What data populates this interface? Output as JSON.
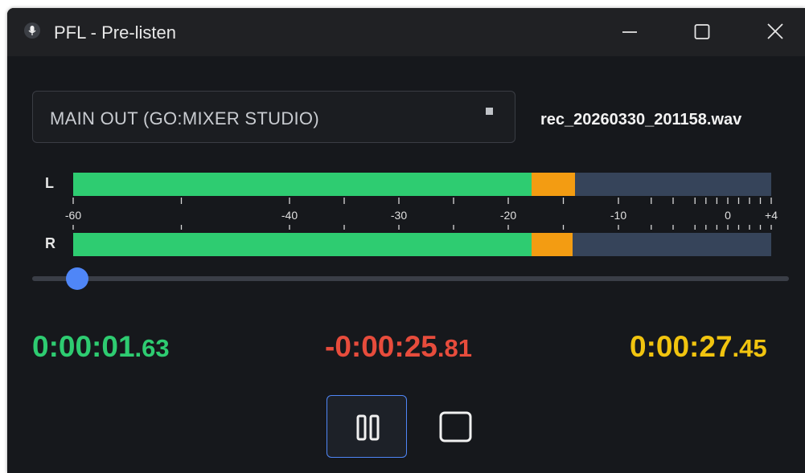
{
  "window": {
    "title": "PFL - Pre-listen",
    "icons": [
      "microphone-icon",
      "minimize-icon",
      "maximize-icon",
      "close-icon"
    ]
  },
  "device": {
    "selected": "MAIN OUT (GO:MIXER STUDIO)"
  },
  "file": {
    "name": "rec_20260330_201158.wav"
  },
  "meters": {
    "left": {
      "label": "L",
      "green_fraction": 0.657,
      "orange_fraction": 0.062
    },
    "right": {
      "label": "R",
      "green_fraction": 0.657,
      "orange_fraction": 0.059
    },
    "scale_labels": [
      "-60",
      "-40",
      "-30",
      "-20",
      "-10",
      "0",
      "+4"
    ],
    "scale_db": [
      -60,
      -40,
      -30,
      -20,
      -10,
      0,
      4
    ],
    "colors": {
      "green": "#2ecc71",
      "orange": "#f39c12",
      "track": "#36445a"
    }
  },
  "seek": {
    "position_fraction": 0.059
  },
  "times": {
    "elapsed": {
      "main": "0:00:01",
      "fraction": ".63"
    },
    "remaining": {
      "main": "-0:00:25",
      "fraction": ".81"
    },
    "total": {
      "main": "0:00:27",
      "fraction": ".45"
    },
    "colors": {
      "elapsed": "#2ecc71",
      "remaining": "#e74c3c",
      "total": "#f1c40f"
    }
  },
  "controls": {
    "pause_icon": "pause-icon",
    "stop_icon": "stop-icon",
    "accent": "#4f86f7"
  }
}
